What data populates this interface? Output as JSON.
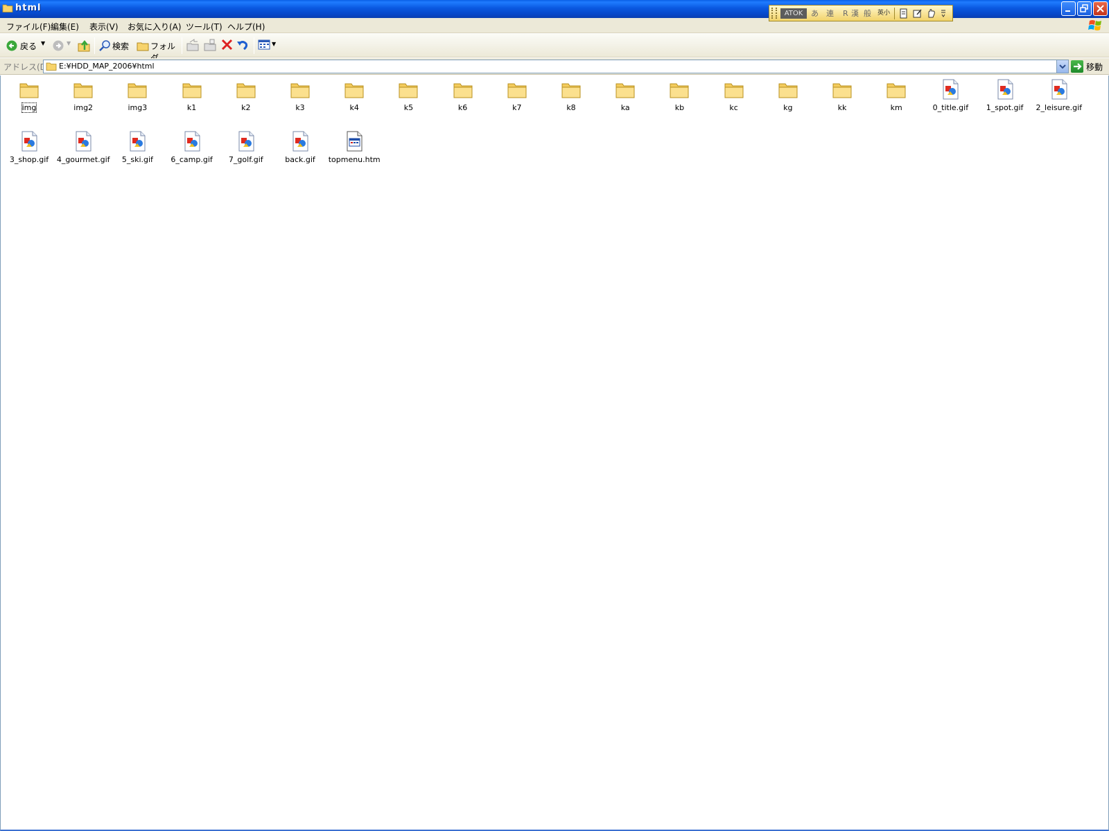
{
  "window": {
    "title": "html"
  },
  "atok": {
    "label": "ATOK",
    "modes": [
      "あ",
      "連",
      "R",
      "漢",
      "般",
      "英小"
    ]
  },
  "menu": {
    "items": [
      "ファイル(F)",
      "編集(E)",
      "表示(V)",
      "お気に入り(A)",
      "ツール(T)",
      "ヘルプ(H)"
    ]
  },
  "toolbar": {
    "back_label": "戻る",
    "search_label": "検索",
    "folders_label": "フォルダ"
  },
  "address": {
    "label": "アドレス(D)",
    "value": "E:¥HDD_MAP_2006¥html",
    "go_label": "移動"
  },
  "files": [
    {
      "name": "img",
      "type": "folder"
    },
    {
      "name": "img2",
      "type": "folder"
    },
    {
      "name": "img3",
      "type": "folder"
    },
    {
      "name": "k1",
      "type": "folder"
    },
    {
      "name": "k2",
      "type": "folder"
    },
    {
      "name": "k3",
      "type": "folder"
    },
    {
      "name": "k4",
      "type": "folder"
    },
    {
      "name": "k5",
      "type": "folder"
    },
    {
      "name": "k6",
      "type": "folder"
    },
    {
      "name": "k7",
      "type": "folder"
    },
    {
      "name": "k8",
      "type": "folder"
    },
    {
      "name": "ka",
      "type": "folder"
    },
    {
      "name": "kb",
      "type": "folder"
    },
    {
      "name": "kc",
      "type": "folder"
    },
    {
      "name": "kg",
      "type": "folder"
    },
    {
      "name": "kk",
      "type": "folder"
    },
    {
      "name": "km",
      "type": "folder"
    },
    {
      "name": "0_title.gif",
      "type": "gif"
    },
    {
      "name": "1_spot.gif",
      "type": "gif"
    },
    {
      "name": "2_leisure.gif",
      "type": "gif"
    },
    {
      "name": "3_shop.gif",
      "type": "gif"
    },
    {
      "name": "4_gourmet.gif",
      "type": "gif"
    },
    {
      "name": "5_ski.gif",
      "type": "gif"
    },
    {
      "name": "6_camp.gif",
      "type": "gif"
    },
    {
      "name": "7_golf.gif",
      "type": "gif"
    },
    {
      "name": "back.gif",
      "type": "gif"
    },
    {
      "name": "topmenu.htm",
      "type": "htm"
    }
  ]
}
